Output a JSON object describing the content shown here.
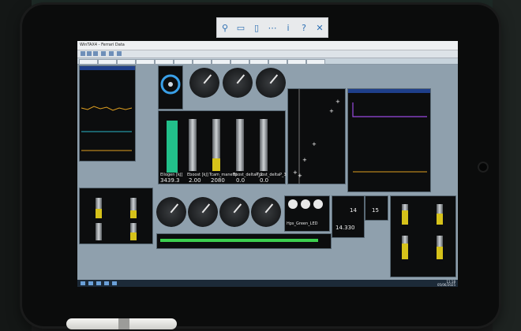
{
  "remote_toolbar": {
    "icons": [
      "pin-icon",
      "keyboard-icon",
      "mouse-icon",
      "more-icon",
      "info-icon",
      "help-icon",
      "close-icon"
    ],
    "labels": [
      "⚲",
      "▭",
      "▯",
      "⋯",
      "i",
      "?",
      "✕"
    ]
  },
  "app": {
    "menu_title": "WinTAX4 - Ferrari Data",
    "gauges_top_labels": [
      "",
      "",
      ""
    ],
    "bar_labels": [
      "Ellogen [kJ]",
      "Eboost [kJ]",
      "Tcam_manetti",
      "Tpost_deltaP_2",
      "Tpost_deltaP_3"
    ],
    "bar_values": [
      "3439.3",
      "2.00",
      "2080",
      "0.0",
      "0.0"
    ],
    "right_values": [
      "14",
      "15"
    ],
    "led_label": "Hps_Green_LED",
    "bottom_value": "14.330",
    "clock_time": "11:18",
    "clock_date": "05/06/2025",
    "colors": {
      "accent": "#1f3f8a",
      "yellow": "#d6c21a",
      "green": "#22c08a"
    }
  }
}
